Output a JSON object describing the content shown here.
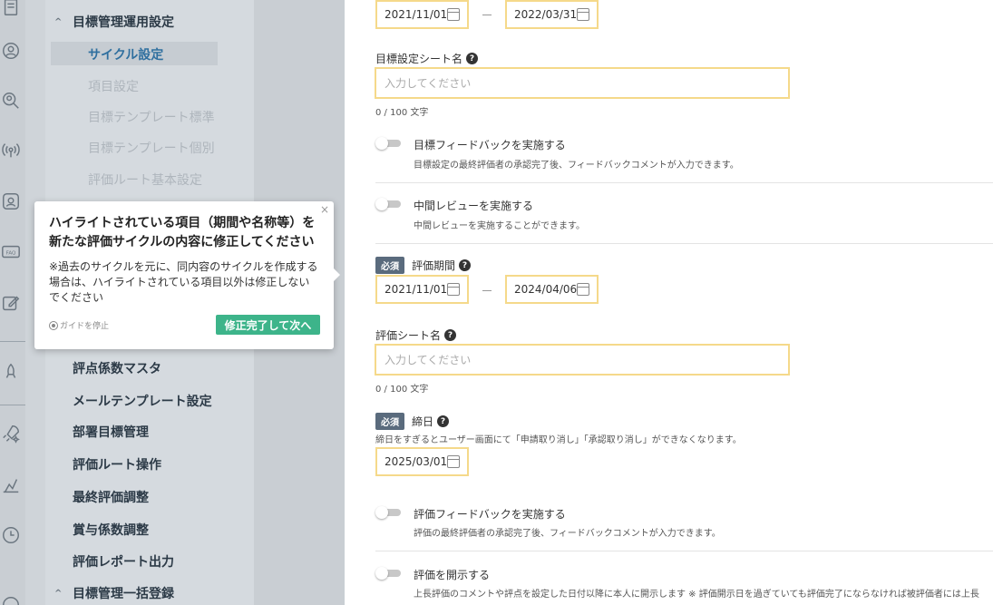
{
  "sidebar": {
    "group_top": "目標管理運用設定",
    "items": [
      {
        "label": "サイクル設定"
      },
      {
        "label": "項目設定"
      },
      {
        "label": "目標テンプレート標準"
      },
      {
        "label": "目標テンプレート個別"
      },
      {
        "label": "評価ルート基本設定"
      }
    ],
    "main_items": [
      {
        "label": "評点係数マスタ"
      },
      {
        "label": "メールテンプレート設定"
      },
      {
        "label": "部署目標管理"
      },
      {
        "label": "評価ルート操作"
      },
      {
        "label": "最終評価調整"
      },
      {
        "label": "賞与係数調整"
      },
      {
        "label": "評価レポート出力"
      }
    ],
    "group_bottom": "目標管理一括登録",
    "rail_icons": [
      "document-icon",
      "user-icon",
      "search-user-icon",
      "broadcast-icon",
      "profile-icon",
      "faq-icon",
      "edit-icon",
      "rocket-icon",
      "rocket-star-icon",
      "chart-icon",
      "clock-icon"
    ]
  },
  "form": {
    "goal_period": {
      "start": "2021/11/01",
      "end": "2022/03/31"
    },
    "goal_sheet_name": {
      "label": "目標設定シート名",
      "placeholder": "入力してください",
      "counter": "0 / 100 文字"
    },
    "goal_feedback": {
      "title": "目標フィードバックを実施する",
      "desc": "目標設定の最終評価者の承認完了後、フィードバックコメントが入力できます。"
    },
    "mid_review": {
      "title": "中間レビューを実施する",
      "desc": "中間レビューを実施することができます。"
    },
    "eval_period": {
      "badge": "必須",
      "label": "評価期間",
      "start": "2021/11/01",
      "end": "2024/04/06"
    },
    "eval_sheet_name": {
      "label": "評価シート名",
      "placeholder": "入力してください",
      "counter": "0 / 100 文字"
    },
    "deadline": {
      "badge": "必須",
      "label": "締日",
      "desc": "締日をすぎるとユーザー画面にて「申請取り消し」「承認取り消し」ができなくなります。",
      "date": "2025/03/01"
    },
    "eval_feedback": {
      "title": "評価フィードバックを実施する",
      "desc": "評価の最終評価者の承認完了後、フィードバックコメントが入力できます。"
    },
    "eval_disclose": {
      "title": "評価を開示する",
      "desc": "上長評価のコメントや評点を設定した日付以降に本人に開示します ※ 評価開示日を過ぎていても評価完了にならなければ被評価者には上長"
    }
  },
  "tooltip": {
    "close": "×",
    "title": "ハイライトされている項目（期間や名称等）を新たな評価サイクルの内容に修正してください",
    "body": "※過去のサイクルを元に、同内容のサイクルを作成する場合は、ハイライトされている項目以外は修正しないでください",
    "stop_guide": "ガイドを停止",
    "next_button": "修正完了して次へ"
  },
  "help_glyph": "?"
}
